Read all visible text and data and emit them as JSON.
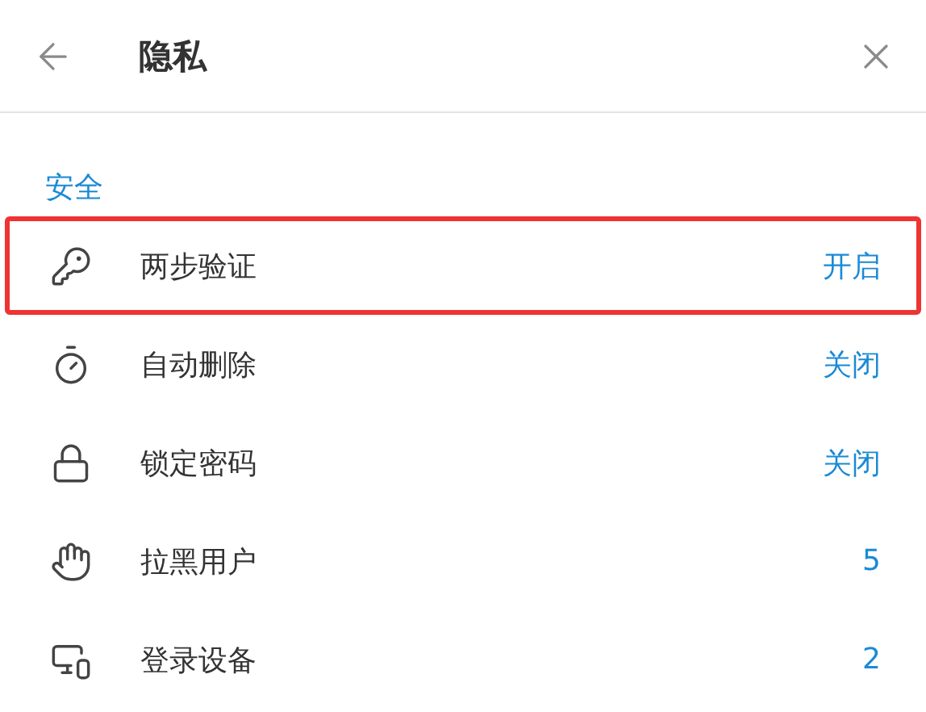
{
  "header": {
    "title": "隐私"
  },
  "section": {
    "title": "安全"
  },
  "rows": [
    {
      "kind": "key",
      "label": "两步验证",
      "value": "开启",
      "highlighted": true
    },
    {
      "kind": "timer",
      "label": "自动删除",
      "value": "关闭",
      "highlighted": false
    },
    {
      "kind": "lock",
      "label": "锁定密码",
      "value": "关闭",
      "highlighted": false
    },
    {
      "kind": "hand",
      "label": "拉黑用户",
      "value": "5",
      "highlighted": false
    },
    {
      "kind": "devices",
      "label": "登录设备",
      "value": "2",
      "highlighted": false
    }
  ]
}
